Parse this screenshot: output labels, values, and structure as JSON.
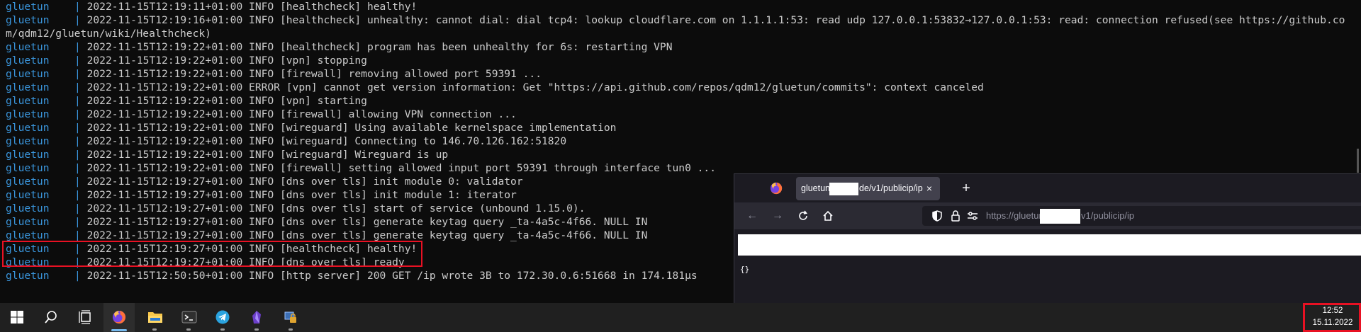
{
  "terminal": {
    "service": "gluetun",
    "separator": "|",
    "lines": [
      "2022-11-15T12:19:11+01:00 INFO [healthcheck] healthy!",
      "2022-11-15T12:19:16+01:00 INFO [healthcheck] unhealthy: cannot dial: dial tcp4: lookup cloudflare.com on 1.1.1.1:53: read udp 127.0.0.1:53832→127.0.0.1:53: read: connection refused(see https://github.com/qdm12/gluetun/wiki/Healthcheck)",
      "2022-11-15T12:19:22+01:00 INFO [healthcheck] program has been unhealthy for 6s: restarting VPN",
      "2022-11-15T12:19:22+01:00 INFO [vpn] stopping",
      "2022-11-15T12:19:22+01:00 INFO [firewall] removing allowed port 59391 ...",
      "2022-11-15T12:19:22+01:00 ERROR [vpn] cannot get version information: Get \"https://api.github.com/repos/qdm12/gluetun/commits\": context canceled",
      "2022-11-15T12:19:22+01:00 INFO [vpn] starting",
      "2022-11-15T12:19:22+01:00 INFO [firewall] allowing VPN connection ...",
      "2022-11-15T12:19:22+01:00 INFO [wireguard] Using available kernelspace implementation",
      "2022-11-15T12:19:22+01:00 INFO [wireguard] Connecting to 146.70.126.162:51820",
      "2022-11-15T12:19:22+01:00 INFO [wireguard] Wireguard is up",
      "2022-11-15T12:19:22+01:00 INFO [firewall] setting allowed input port 59391 through interface tun0 ...",
      "2022-11-15T12:19:27+01:00 INFO [dns over tls] init module 0: validator",
      "2022-11-15T12:19:27+01:00 INFO [dns over tls] init module 1: iterator",
      "2022-11-15T12:19:27+01:00 INFO [dns over tls] start of service (unbound 1.15.0).",
      "2022-11-15T12:19:27+01:00 INFO [dns over tls] generate keytag query _ta-4a5c-4f66. NULL IN",
      "2022-11-15T12:19:27+01:00 INFO [dns over tls] generate keytag query _ta-4a5c-4f66. NULL IN",
      "2022-11-15T12:19:27+01:00 INFO [healthcheck] healthy!",
      "2022-11-15T12:19:27+01:00 INFO [dns over tls] ready",
      "2022-11-15T12:50:50+01:00 INFO [http server] 200 GET /ip wrote 3B to 172.30.0.6:51668 in 174.181µs"
    ]
  },
  "browser": {
    "tab": {
      "title_start": "gluetun",
      "title_end": "de/v1/publicip/ip",
      "close": "×"
    },
    "new_tab": "+",
    "url": {
      "start": "https://gluetun.",
      "end": "v1/publicip/ip"
    },
    "body_text": "{}"
  },
  "taskbar": {
    "apps": [
      "windows-start",
      "search",
      "task-view",
      "firefox",
      "file-explorer",
      "terminal",
      "telegram",
      "obsidian",
      "remote-network"
    ],
    "time": "12:52",
    "date": "15.11.2022"
  },
  "colors": {
    "service_name": "#3a96dd",
    "terminal_text": "#cccccc",
    "highlight": "#e81123"
  }
}
